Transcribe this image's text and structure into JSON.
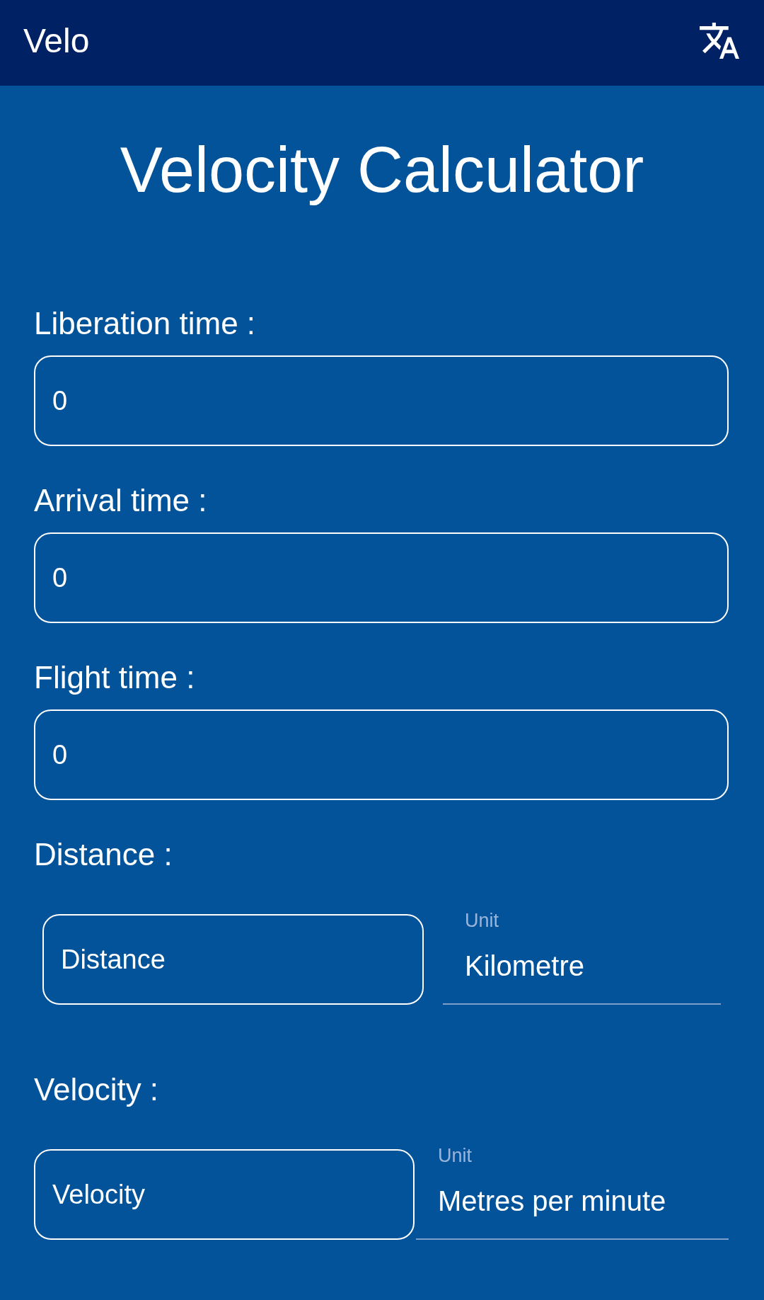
{
  "app_bar": {
    "title": "Velo"
  },
  "heading": "Velocity Calculator",
  "fields": [
    {
      "kind": "text",
      "label": "Liberation time :",
      "value": "0"
    },
    {
      "kind": "text",
      "label": "Arrival time :",
      "value": "0"
    },
    {
      "kind": "text",
      "label": "Flight time :",
      "value": "0"
    },
    {
      "kind": "unit",
      "label": "Distance :",
      "placeholder": "Distance",
      "unit": {
        "label": "Unit",
        "value": "Kilometre"
      }
    },
    {
      "kind": "unit",
      "label": "Velocity :",
      "placeholder": "Velocity",
      "unit": {
        "label": "Unit",
        "value": "Metres per minute"
      }
    }
  ]
}
